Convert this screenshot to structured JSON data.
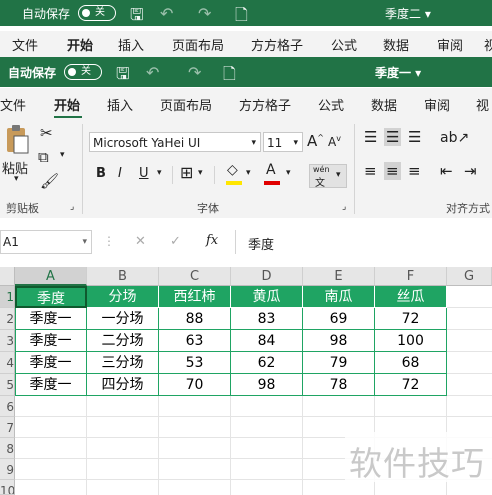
{
  "outer": {
    "autosave_label": "自动保存",
    "autosave_state": "关",
    "doc_title": "季度二 ▾",
    "tabs": [
      "文件",
      "开始",
      "插入",
      "页面布局",
      "方方格子",
      "公式",
      "数据",
      "审阅",
      "视"
    ]
  },
  "inner": {
    "autosave_label": "自动保存",
    "autosave_state": "关",
    "doc_title": "季度一 ▾",
    "tabs": [
      "文件",
      "开始",
      "插入",
      "页面布局",
      "方方格子",
      "公式",
      "数据",
      "审阅",
      "视图"
    ]
  },
  "ribbon": {
    "paste_label": "粘贴",
    "clipboard_group": "剪贴板",
    "font_name": "Microsoft YaHei UI",
    "font_size": "11",
    "grow_font": "A",
    "shrink_font": "A",
    "bold": "B",
    "italic": "I",
    "underline": "U",
    "wen_top": "wén",
    "wen_bottom": "文",
    "font_group": "字体",
    "align_group": "对齐方式",
    "accent_color": "#217346"
  },
  "formula_bar": {
    "name_box": "A1",
    "fx": "fx",
    "cancel": "✕",
    "confirm": "✓",
    "content": "季度"
  },
  "sheet": {
    "columns": [
      "A",
      "B",
      "C",
      "D",
      "E",
      "F",
      "G"
    ],
    "rows": [
      "1",
      "2",
      "3",
      "4",
      "5",
      "6",
      "7",
      "8",
      "9",
      "10"
    ],
    "header": [
      "季度",
      "分场",
      "西红柿",
      "黄瓜",
      "南瓜",
      "丝瓜"
    ],
    "data": [
      [
        "季度一",
        "一分场",
        "88",
        "83",
        "69",
        "72"
      ],
      [
        "季度一",
        "二分场",
        "63",
        "84",
        "98",
        "100"
      ],
      [
        "季度一",
        "三分场",
        "53",
        "62",
        "79",
        "68"
      ],
      [
        "季度一",
        "四分场",
        "70",
        "98",
        "78",
        "72"
      ]
    ]
  },
  "watermark": "软件技巧"
}
